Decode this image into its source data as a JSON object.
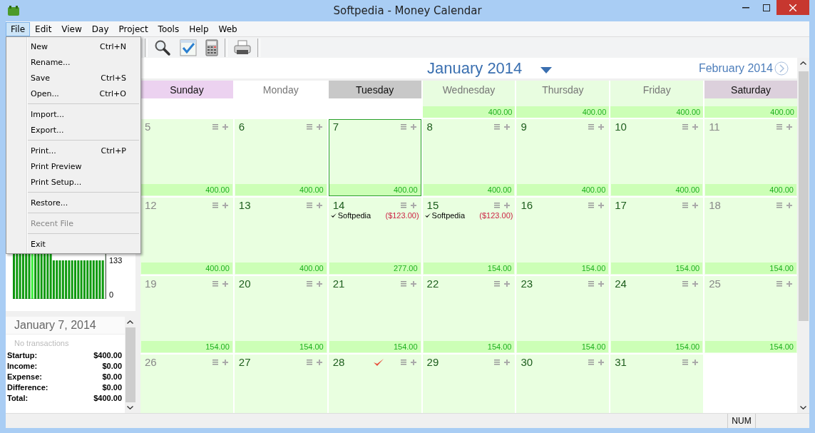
{
  "window": {
    "title": "Softpedia - Money Calendar"
  },
  "menu_bar": [
    {
      "label": "File",
      "selected": true
    },
    {
      "label": "Edit",
      "selected": false
    },
    {
      "label": "View",
      "selected": false
    },
    {
      "label": "Day",
      "selected": false
    },
    {
      "label": "Project",
      "selected": false
    },
    {
      "label": "Tools",
      "selected": false
    },
    {
      "label": "Help",
      "selected": false
    },
    {
      "label": "Web",
      "selected": false
    }
  ],
  "file_menu": [
    {
      "kind": "item",
      "label": "New",
      "shortcut": "Ctrl+N",
      "disabled": false
    },
    {
      "kind": "item",
      "label": "Rename...",
      "disabled": false
    },
    {
      "kind": "item",
      "label": "Save",
      "shortcut": "Ctrl+S",
      "disabled": false
    },
    {
      "kind": "item",
      "label": "Open...",
      "shortcut": "Ctrl+O",
      "disabled": false
    },
    {
      "kind": "separator"
    },
    {
      "kind": "item",
      "label": "Import...",
      "disabled": false
    },
    {
      "kind": "item",
      "label": "Export...",
      "disabled": false
    },
    {
      "kind": "separator"
    },
    {
      "kind": "item",
      "label": "Print...",
      "shortcut": "Ctrl+P",
      "disabled": false
    },
    {
      "kind": "item",
      "label": "Print Preview",
      "disabled": false
    },
    {
      "kind": "item",
      "label": "Print Setup...",
      "disabled": false
    },
    {
      "kind": "separator"
    },
    {
      "kind": "item",
      "label": "Restore...",
      "disabled": false
    },
    {
      "kind": "separator"
    },
    {
      "kind": "item",
      "label": "Recent File",
      "disabled": true
    },
    {
      "kind": "separator"
    },
    {
      "kind": "item",
      "label": "Exit",
      "disabled": false
    }
  ],
  "balance_chart": {
    "tick_labels": [
      "133",
      "0"
    ]
  },
  "day_summary": {
    "date": "January 7, 2014",
    "note": "No transactions",
    "rows": [
      {
        "label": "Startup:",
        "value": "$400.00"
      },
      {
        "label": "Income:",
        "value": "$0.00"
      },
      {
        "label": "Expense:",
        "value": "$0.00"
      },
      {
        "label": "Difference:",
        "value": "$0.00"
      },
      {
        "label": "Total:",
        "value": "$400.00"
      }
    ]
  },
  "calendar": {
    "month": "January 2014",
    "next_month": "February 2014",
    "headers": [
      {
        "label": "Sunday",
        "color": "#ecd2f0",
        "kind": "marked"
      },
      {
        "label": "Monday",
        "color": "#ffffff",
        "kind": "plain"
      },
      {
        "label": "Tuesday",
        "color": "#c8c8c8",
        "kind": "marked"
      },
      {
        "label": "Wednesday",
        "color": "#e8fde0",
        "kind": "plain",
        "balance": "400.00"
      },
      {
        "label": "Thursday",
        "color": "#e8fde0",
        "kind": "plain",
        "balance": "400.00"
      },
      {
        "label": "Friday",
        "color": "#e8fde0",
        "kind": "plain",
        "balance": "400.00"
      },
      {
        "label": "Saturday",
        "color": "#dcd0dc",
        "kind": "marked",
        "balance": "400.00"
      }
    ],
    "weeks": [
      [
        {
          "day": "5",
          "weekend": true,
          "selected": false,
          "balance": "400.00"
        },
        {
          "day": "6",
          "weekend": false,
          "selected": false,
          "balance": "400.00"
        },
        {
          "day": "7",
          "weekend": false,
          "selected": true,
          "balance": "400.00"
        },
        {
          "day": "8",
          "weekend": false,
          "selected": false,
          "balance": "400.00"
        },
        {
          "day": "9",
          "weekend": false,
          "selected": false,
          "balance": "400.00"
        },
        {
          "day": "10",
          "weekend": false,
          "selected": false,
          "balance": "400.00"
        },
        {
          "day": "11",
          "weekend": true,
          "selected": false,
          "balance": "400.00"
        }
      ],
      [
        {
          "day": "12",
          "weekend": true,
          "selected": false,
          "balance": "400.00"
        },
        {
          "day": "13",
          "weekend": false,
          "selected": false,
          "balance": "400.00"
        },
        {
          "day": "14",
          "weekend": false,
          "selected": false,
          "balance": "277.00",
          "transactions": [
            {
              "name": "Softpedia",
              "amount": "($123.00)",
              "done": true
            }
          ]
        },
        {
          "day": "15",
          "weekend": false,
          "selected": false,
          "balance": "154.00",
          "transactions": [
            {
              "name": "Softpedia",
              "amount": "($123.00)",
              "done": true
            }
          ]
        },
        {
          "day": "16",
          "weekend": false,
          "selected": false,
          "balance": "154.00"
        },
        {
          "day": "17",
          "weekend": false,
          "selected": false,
          "balance": "154.00"
        },
        {
          "day": "18",
          "weekend": true,
          "selected": false,
          "balance": "154.00"
        }
      ],
      [
        {
          "day": "19",
          "weekend": true,
          "selected": false,
          "balance": "154.00"
        },
        {
          "day": "20",
          "weekend": false,
          "selected": false,
          "balance": "154.00"
        },
        {
          "day": "21",
          "weekend": false,
          "selected": false,
          "balance": "154.00"
        },
        {
          "day": "22",
          "weekend": false,
          "selected": false,
          "balance": "154.00"
        },
        {
          "day": "23",
          "weekend": false,
          "selected": false,
          "balance": "154.00"
        },
        {
          "day": "24",
          "weekend": false,
          "selected": false,
          "balance": "154.00"
        },
        {
          "day": "25",
          "weekend": true,
          "selected": false,
          "balance": "154.00"
        }
      ],
      [
        {
          "day": "26",
          "weekend": true,
          "selected": false
        },
        {
          "day": "27",
          "weekend": false,
          "selected": false
        },
        {
          "day": "28",
          "weekend": false,
          "selected": false,
          "flagged": true
        },
        {
          "day": "29",
          "weekend": false,
          "selected": false
        },
        {
          "day": "30",
          "weekend": false,
          "selected": false
        },
        {
          "day": "31",
          "weekend": false,
          "selected": false
        },
        {
          "kind": "empty"
        }
      ]
    ]
  },
  "status_bar": {
    "indicator": "NUM"
  }
}
